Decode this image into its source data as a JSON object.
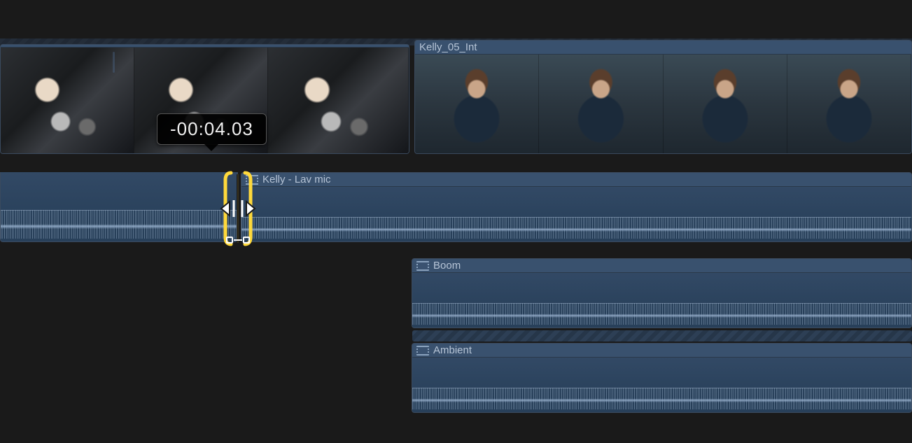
{
  "timeline": {
    "timecode_delta_label": "-00:04.03",
    "clips": {
      "video_left": {
        "title": "",
        "thumb_style": "car"
      },
      "video_right": {
        "title": "Kelly_05_Int",
        "thumb_style": "person"
      },
      "audio_lav": {
        "title": "Kelly - Lav mic"
      },
      "audio_boom": {
        "title": "Boom"
      },
      "audio_ambient": {
        "title": "Ambient"
      }
    },
    "icons": {
      "film": "film"
    }
  }
}
